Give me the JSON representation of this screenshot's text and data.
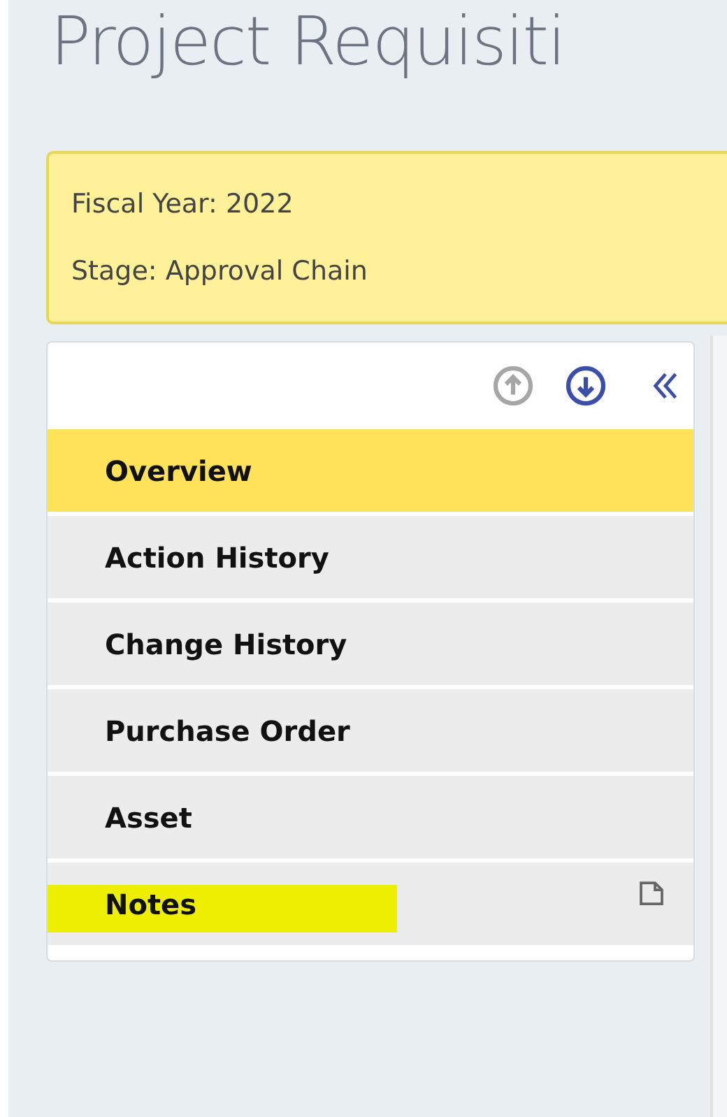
{
  "page_title": "Project Requisiti",
  "info_box": {
    "lines": [
      "Fiscal Year: 2022",
      "Stage: Approval Chain"
    ]
  },
  "sidebar": {
    "move_up_disabled": true,
    "move_down_disabled": false,
    "items": [
      {
        "label": "Overview",
        "selected": true,
        "highlighted": false,
        "kind": "plain"
      },
      {
        "label": "Action History",
        "selected": false,
        "highlighted": false,
        "kind": "plain"
      },
      {
        "label": "Change History",
        "selected": false,
        "highlighted": false,
        "kind": "plain"
      },
      {
        "label": "Purchase Order",
        "selected": false,
        "highlighted": false,
        "kind": "plain"
      },
      {
        "label": "Asset",
        "selected": false,
        "highlighted": false,
        "kind": "plain"
      },
      {
        "label": "Notes",
        "selected": false,
        "highlighted": true,
        "kind": "note"
      }
    ]
  }
}
